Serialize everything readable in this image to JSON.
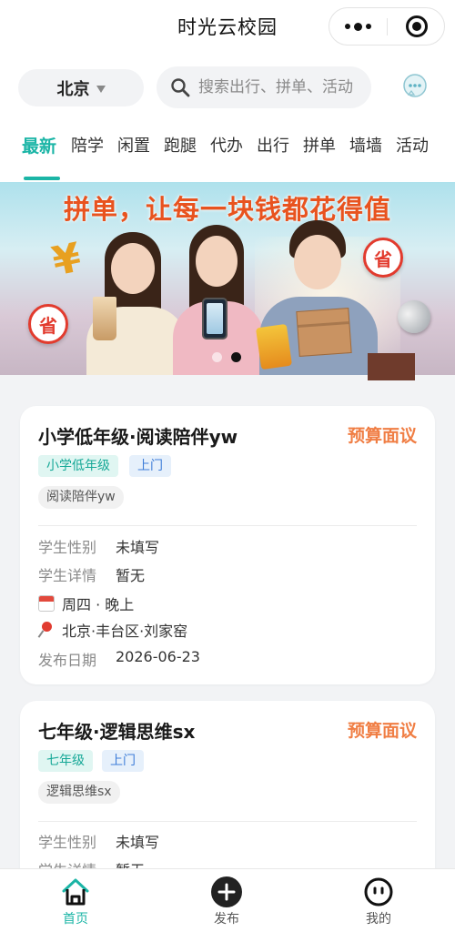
{
  "header": {
    "title": "时光云校园"
  },
  "city": {
    "label": "北京"
  },
  "search": {
    "placeholder": "搜索出行、拼单、活动"
  },
  "tabs": [
    {
      "label": "最新",
      "active": true
    },
    {
      "label": "陪学",
      "active": false
    },
    {
      "label": "闲置",
      "active": false
    },
    {
      "label": "跑腿",
      "active": false
    },
    {
      "label": "代办",
      "active": false
    },
    {
      "label": "出行",
      "active": false
    },
    {
      "label": "拼单",
      "active": false
    },
    {
      "label": "墙墙",
      "active": false
    },
    {
      "label": "活动",
      "active": false
    }
  ],
  "banner": {
    "headline": "拼单，让每一块钱都花得值",
    "badge": "省",
    "current_slide": 2,
    "slide_count": 2
  },
  "cards": [
    {
      "title": "小学低年级·阅读陪伴yw",
      "budget": "预算面议",
      "tags": [
        "小学低年级",
        "上门"
      ],
      "chip": "阅读陪伴yw",
      "gender_label": "学生性别",
      "gender_value": "未填写",
      "detail_label": "学生详情",
      "detail_value": "暂无",
      "schedule": "周四 · 晚上",
      "location": "北京·丰台区·刘家窑",
      "date_label": "发布日期",
      "date_value": "2026-06-23"
    },
    {
      "title": "七年级·逻辑思维sx",
      "budget": "预算面议",
      "tags": [
        "七年级",
        "上门"
      ],
      "chip": "逻辑思维sx",
      "gender_label": "学生性别",
      "gender_value": "未填写",
      "detail_label": "学生详情",
      "detail_value": "暂无"
    }
  ],
  "bottom_nav": [
    {
      "label": "首页",
      "icon": "home-icon",
      "active": true
    },
    {
      "label": "发布",
      "icon": "plus-circle-icon",
      "active": false
    },
    {
      "label": "我的",
      "icon": "profile-face-icon",
      "active": false
    }
  ],
  "colors": {
    "accent": "#1bb5a6",
    "budget": "#f07e44",
    "banner_headline": "#e8531f"
  }
}
